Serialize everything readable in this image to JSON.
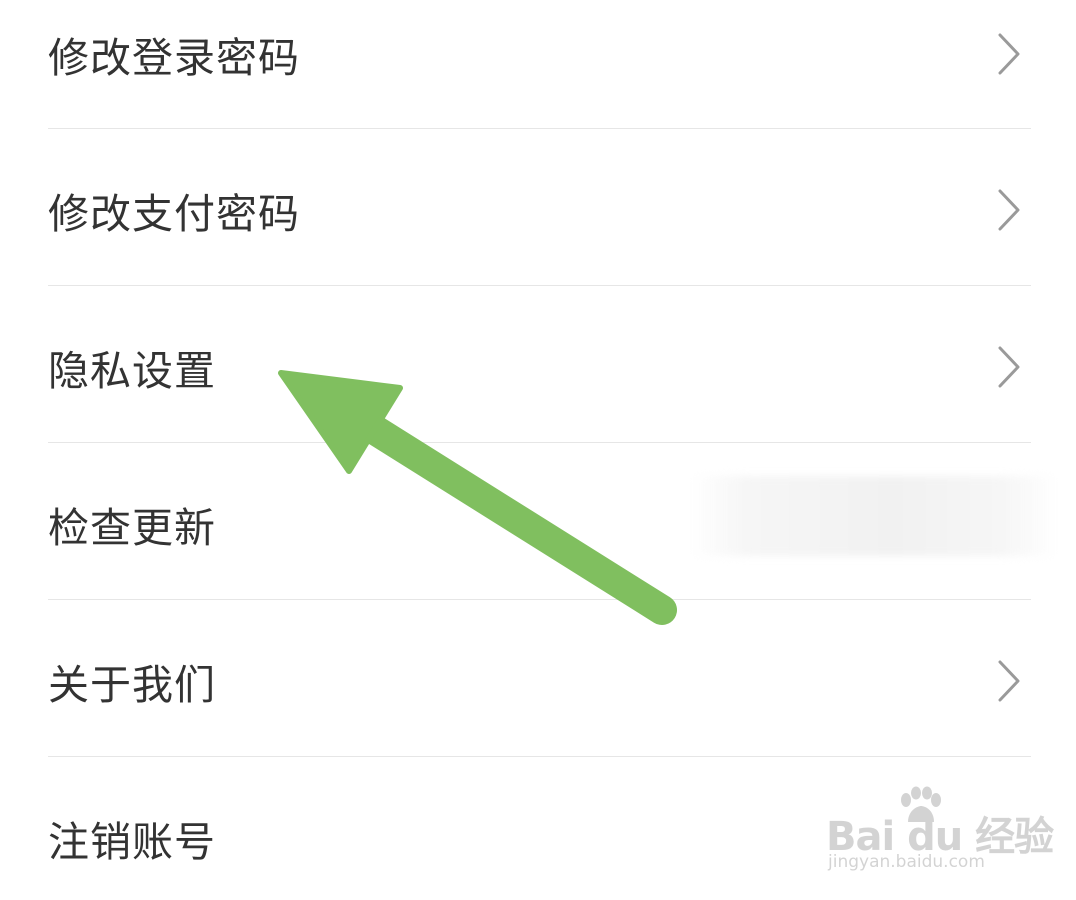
{
  "settings": {
    "items": [
      {
        "label": "修改登录密码",
        "has_chevron": true
      },
      {
        "label": "修改支付密码",
        "has_chevron": true
      },
      {
        "label": "隐私设置",
        "has_chevron": true
      },
      {
        "label": "检查更新",
        "has_chevron": false
      },
      {
        "label": "关于我们",
        "has_chevron": true
      },
      {
        "label": "注销账号",
        "has_chevron": false
      }
    ]
  },
  "icons": {
    "chevron": "chevron-right-icon",
    "arrow": "arrow-icon",
    "watermark": "baidu-logo-watermark"
  },
  "annotation": {
    "color": "#80bf5f",
    "points_to": "隐私设置"
  },
  "watermark": {
    "main_text": "Bai du 经验",
    "sub_text": "jingyan.baidu.com"
  },
  "colors": {
    "text": "#333333",
    "divider": "#e6e6e6",
    "chevron": "#9a9a9a",
    "background": "#ffffff"
  }
}
